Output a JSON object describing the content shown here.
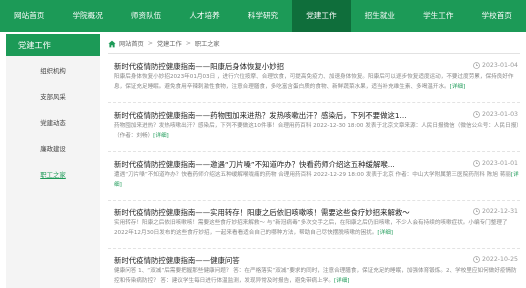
{
  "nav": {
    "items": [
      "网站首页",
      "学院概况",
      "师资队伍",
      "人才培养",
      "科学研究",
      "党建工作",
      "招生就业",
      "学生工作",
      "学校首页"
    ],
    "active_index": 5
  },
  "sidebar": {
    "title": "党建工作",
    "items": [
      "组织机构",
      "支部风采",
      "党建动态",
      "廉政建设",
      "职工之家"
    ],
    "active_index": 4
  },
  "breadcrumb": {
    "items": [
      "网站首页",
      "党建工作",
      "职工之家"
    ],
    "separator": ">"
  },
  "articles": [
    {
      "title": "新时代疫情防控健康指南——阳康后身体恢复小妙招",
      "date": "2023-01-04",
      "summary": "阳康后身体恢复小妙招2023年01月03日 ，进行穴位按摩、合理饮食，可提高免疫力、加速身体恢复。阳康后可以逐步恢复适度运动，不要过度劳累，保持良好作息，保证充足睡眠。避免食用辛辣刺激性食物，注意合理膳食，多吃富含蛋白质的食物、新鲜蔬菜水果，适当补充维生素、多喝温开水。",
      "more": "[详细]"
    },
    {
      "title": "新时代疫情防控健康指南——药物囤加来进热？发热咳嗽出汗？感染后，下列不要做这1...",
      "date": "2023-01-03",
      "summary": "药物囤加来进热？发热咳嗽出汗？感染后，下列不要做这10件事！合理用药百科 2022-12-30 18:00 发表于北京文章来源：人民日报微信（微信公众号：人民日报）（作者：刘畅）",
      "more": "[详细]"
    },
    {
      "title": "新时代疫情防控健康指南——邀遇“刀片嗓”不知道咋办？快看药师介绍这五种缓解喉...",
      "date": "2023-01-01",
      "summary": "遭遇“刀片嗓”不知道咋办？快看药师介绍这五种缓解喉咙痛的药物 合理用药百科 2022-12-29 18:00 发表于北京 作者：中山大学附属第三医院药剂科 陈旭 蒋丽",
      "more": "[详细]"
    },
    {
      "title": "新时代疫情防控健康指南——实用转存！阳康之后依旧咳嗽咳！需要这些食疗妙招来解救～",
      "date": "2022-12-31",
      "summary": "实用转存！阳康之后依旧咳嗽咳！需要这些食疗妙招来解救～ 与“新冠病毒”多次交手之后，在阳康之后仍旧咳嗽，不少人会有持续的咳嗽症状。小编专门整理了2022年12月30日发布的这些食疗妙招，一起来看看适合自己的哪种方法，帮助自己尽快摆脱咳嗽的困扰。",
      "more": "[详细]"
    },
    {
      "title": "新时代疫情防控健康指南——健康问答",
      "date": "2022-10-25",
      "summary": "健康问答 1、“双减”后需要把握那些健康问题？ 答：在严格落实“双减”要求的同时，注意合理膳食，保证充足的睡眠，加强体育锻炼。2、学校里应如何做好疫情防控和传染病防控？ 答：建议学生每日进行体温监测，发现异常及时报告，避免带病上学。",
      "more": "[详细]"
    }
  ],
  "colors": {
    "accent": "#1c9a57",
    "accent_dark": "#0f6e3b"
  }
}
